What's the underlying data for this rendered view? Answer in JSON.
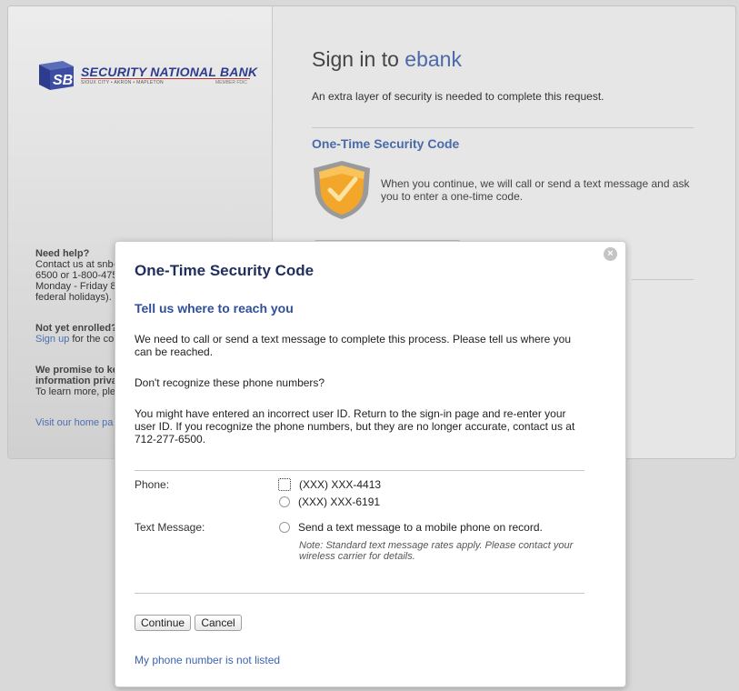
{
  "bank": {
    "logo_text": "SECURITY NATIONAL BANK",
    "logo_sub": "SIOUX CITY • AKRON • MAPLETON",
    "logo_fdic": "MEMBER FDIC",
    "logo_mark": "SB"
  },
  "sidebar": {
    "help_title": "Need help?",
    "help_lines": [
      "Contact us at snb-",
      "6500 or 1-800-475",
      "Monday - Friday 8",
      "federal holidays)."
    ],
    "enroll_title": "Not yet enrolled?",
    "enroll_link": "Sign up",
    "enroll_rest": " for the co",
    "privacy_lines": [
      "We promise to ke",
      "information priva"
    ],
    "privacy_text": "To learn more, ple",
    "home_link": "Visit our home pa"
  },
  "main": {
    "title_prefix": "Sign in to ",
    "title_brand": "ebank",
    "description": "An extra layer of security is needed to complete this request.",
    "section_heading": "One-Time Security Code",
    "section_text": "When you continue, we will call or send a text message and ask you to enter a one-time code."
  },
  "modal": {
    "close_symbol": "×",
    "title": "One-Time Security Code",
    "subtitle": "Tell us where to reach you",
    "para1": "We need to call or send a text message to complete this process. Please tell us where you can be reached.",
    "para2": "Don't recognize these phone numbers?",
    "para3": "You might have entered an incorrect user ID. Return to the sign-in page and re-enter your user ID. If you recognize the phone numbers, but they are no longer accurate, contact us at 712-277-6500.",
    "phone_label": "Phone:",
    "phone_options": [
      "(XXX) XXX-4413",
      "(XXX) XXX-6191"
    ],
    "text_label": "Text Message:",
    "text_option": "Send a text message to a mobile phone on record.",
    "note": "Note: Standard text message rates apply. Please contact your wireless carrier for details.",
    "continue_label": "Continue",
    "cancel_label": "Cancel",
    "not_listed_link": "My phone number is not listed"
  },
  "colors": {
    "brand_blue": "#2d3c8c",
    "link_blue": "#3e63b0",
    "shield_gold": "#f2a72a"
  }
}
